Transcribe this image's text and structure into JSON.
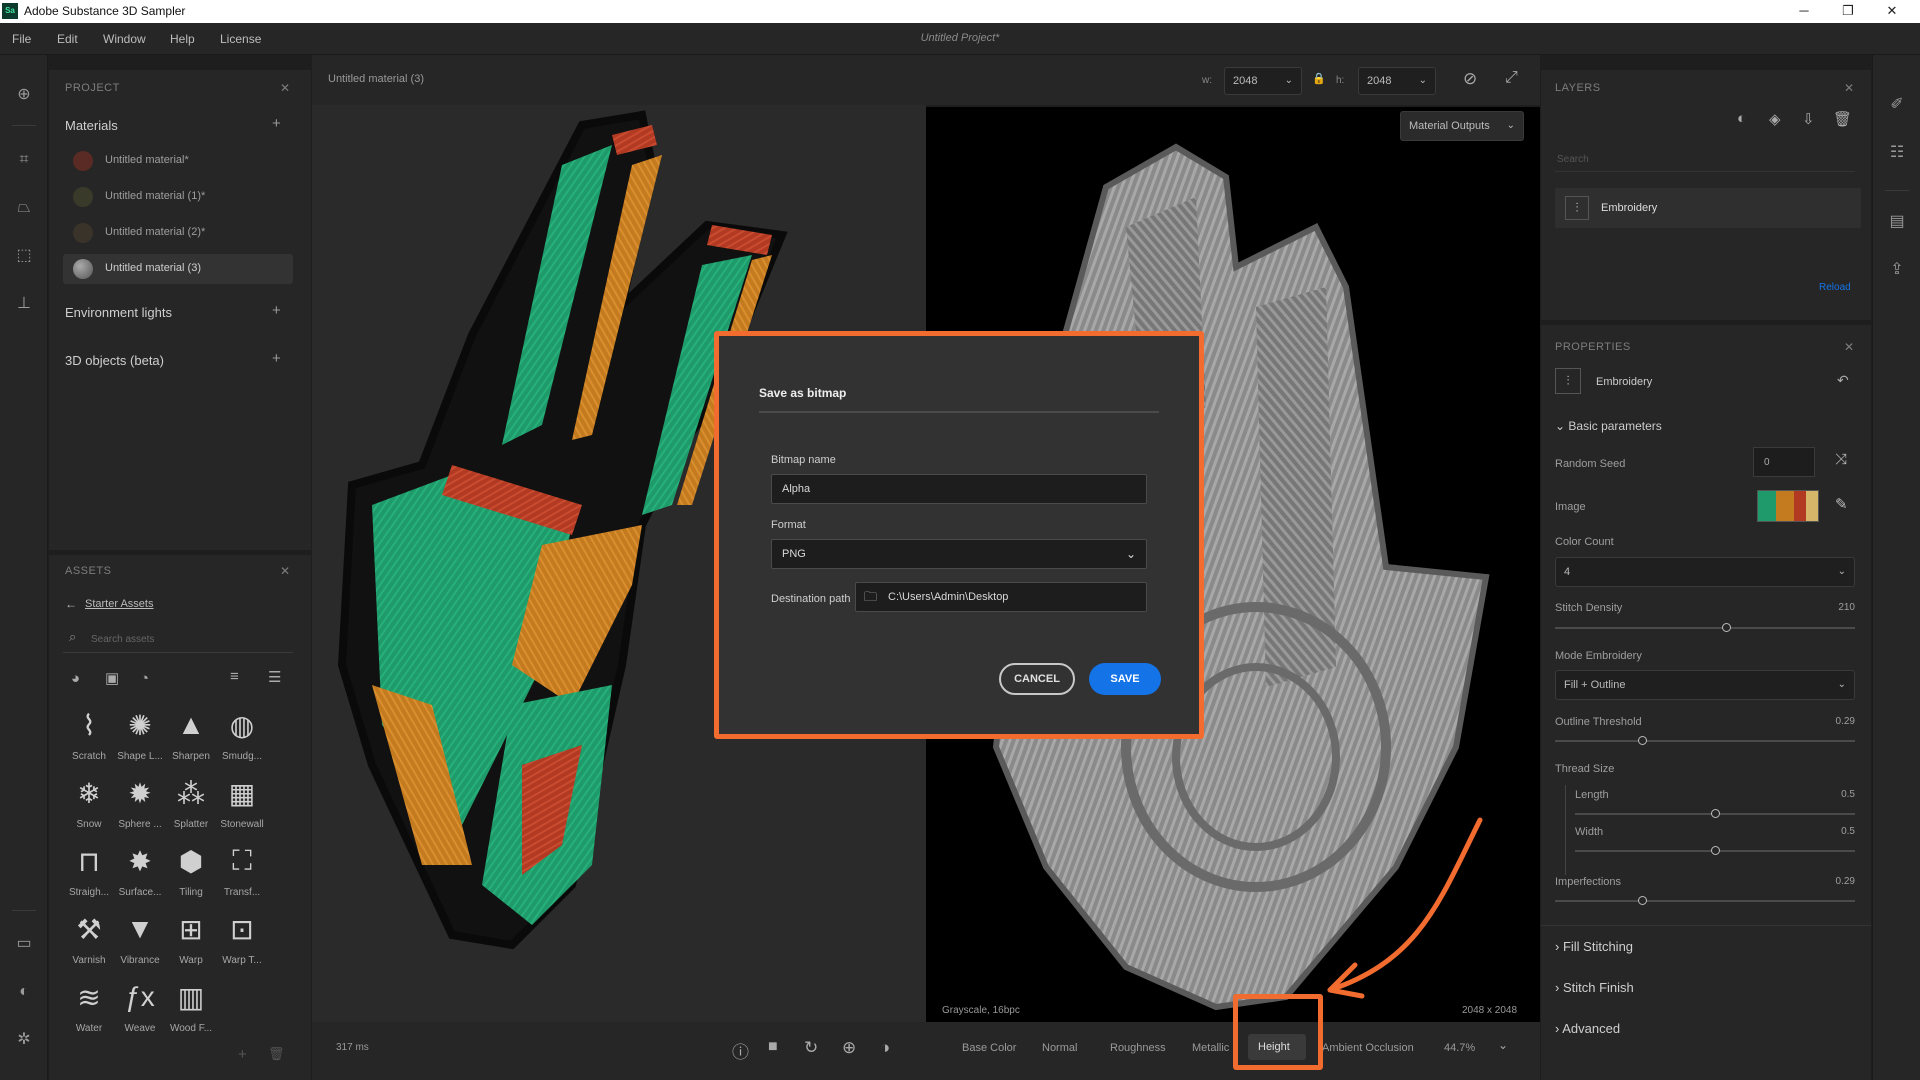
{
  "window": {
    "app_badge": "Sa",
    "title": "Adobe Substance 3D Sampler",
    "controls": {
      "minimize": "─",
      "maximize": "❐",
      "close": "✕"
    }
  },
  "menu": {
    "items": [
      "File",
      "Edit",
      "Window",
      "Help",
      "License"
    ],
    "project_title": "Untitled Project*"
  },
  "project": {
    "title": "PROJECT",
    "close": "✕",
    "materials_heading": "Materials",
    "materials": [
      {
        "name": "Untitled material*",
        "thumb": "#5a2a24"
      },
      {
        "name": "Untitled material (1)*",
        "thumb": "#3a3a2a"
      },
      {
        "name": "Untitled material (2)*",
        "thumb": "#3a332a"
      },
      {
        "name": "Untitled material (3)",
        "thumb": "#8a8a8a"
      }
    ],
    "env_heading": "Environment lights",
    "objects_heading": "3D objects (beta)",
    "add": "+"
  },
  "assets": {
    "title": "ASSETS",
    "close": "✕",
    "breadcrumb": "Starter Assets",
    "back": "←",
    "search_placeholder": "Search assets",
    "items": [
      {
        "label": "Scratch",
        "glyph": "⌇"
      },
      {
        "label": "Shape L...",
        "glyph": "✺"
      },
      {
        "label": "Sharpen",
        "glyph": "▲"
      },
      {
        "label": "Smudg...",
        "glyph": "◍"
      },
      {
        "label": "Snow",
        "glyph": "❄"
      },
      {
        "label": "Sphere ...",
        "glyph": "✹"
      },
      {
        "label": "Splatter",
        "glyph": "⁂"
      },
      {
        "label": "Stonewall",
        "glyph": "▦"
      },
      {
        "label": "Straigh...",
        "glyph": "⊓"
      },
      {
        "label": "Surface...",
        "glyph": "✸"
      },
      {
        "label": "Tiling",
        "glyph": "⬢"
      },
      {
        "label": "Transf...",
        "glyph": "⛶"
      },
      {
        "label": "Varnish",
        "glyph": "⚒"
      },
      {
        "label": "Vibrance",
        "glyph": "▼"
      },
      {
        "label": "Warp",
        "glyph": "⊞"
      },
      {
        "label": "Warp T...",
        "glyph": "⊡"
      },
      {
        "label": "Water",
        "glyph": "≋"
      },
      {
        "label": "Weave",
        "glyph": "ƒx"
      },
      {
        "label": "Wood F...",
        "glyph": "▥"
      }
    ]
  },
  "viewport": {
    "material_name": "Untitled material (3)",
    "w_label": "w:",
    "w_value": "2048",
    "h_label": "h:",
    "h_value": "2048",
    "outputs_label": "Material Outputs",
    "render_time": "317 ms",
    "grayscale_info": "Grayscale, 16bpc",
    "resolution": "2048 x 2048",
    "channels": [
      "Base Color",
      "Normal",
      "Roughness",
      "Metallic",
      "Height",
      "Ambient Occlusion"
    ],
    "active_channel": "Height",
    "zoom": "44.7%"
  },
  "layers": {
    "title": "LAYERS",
    "close": "✕",
    "search_placeholder": "Search",
    "layer_name": "Embroidery",
    "reload": "Reload"
  },
  "properties": {
    "title": "PROPERTIES",
    "close": "✕",
    "name": "Embroidery",
    "basic_params": "Basic parameters",
    "random_seed_label": "Random Seed",
    "random_seed_value": "0",
    "image_label": "Image",
    "color_count_label": "Color Count",
    "color_count_value": "4",
    "stitch_density_label": "Stitch Density",
    "stitch_density_value": "210",
    "stitch_density_frac": 0.57,
    "mode_label": "Mode Embroidery",
    "mode_value": "Fill + Outline",
    "outline_label": "Outline Threshold",
    "outline_value": "0.29",
    "outline_frac": 0.29,
    "thread_size_label": "Thread Size",
    "length_label": "Length",
    "length_value": "0.5",
    "length_frac": 0.5,
    "width_label": "Width",
    "width_value": "0.5",
    "width_frac": 0.5,
    "imperfections_label": "Imperfections",
    "imperfections_value": "0.29",
    "imperfections_frac": 0.29,
    "sections": [
      "Fill Stitching",
      "Stitch Finish",
      "Advanced"
    ]
  },
  "dialog": {
    "title": "Save as bitmap",
    "name_label": "Bitmap name",
    "name_value": "Alpha",
    "format_label": "Format",
    "format_value": "PNG",
    "path_label": "Destination path",
    "path_value": "C:\\Users\\Admin\\Desktop",
    "cancel": "CANCEL",
    "save": "SAVE"
  },
  "colors": {
    "accent": "#1473e6",
    "highlight": "#f26b2f",
    "embroidery_green": "#1f9a6a",
    "embroidery_orange": "#c47a1f",
    "embroidery_red": "#b23a22"
  }
}
